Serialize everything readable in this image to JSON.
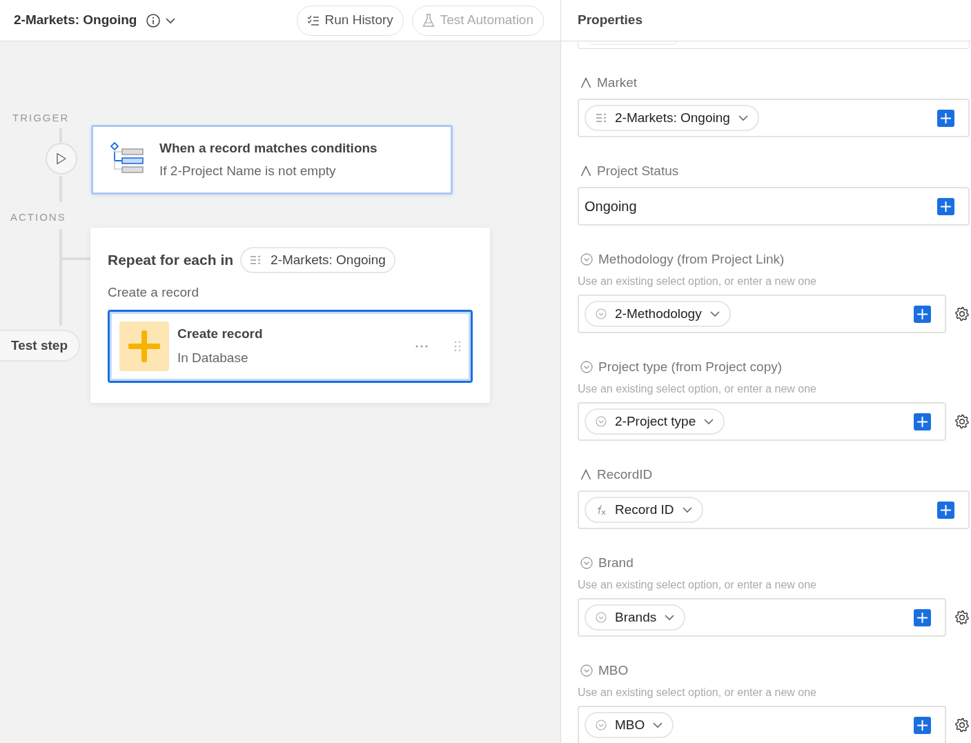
{
  "header": {
    "title": "2-Markets: Ongoing",
    "buttons": [
      {
        "kind": "history",
        "label": "Run History",
        "disabled": false
      },
      {
        "kind": "test",
        "label": "Test Automation",
        "disabled": true
      }
    ]
  },
  "canvas": {
    "trigger_label": "TRIGGER",
    "trigger": {
      "title": "When a record matches conditions",
      "subtitle": "If 2-Project Name is not empty"
    },
    "actions_label": "ACTIONS",
    "repeat": {
      "title": "Repeat for each in",
      "source": "2-Markets: Ongoing",
      "caption": "Create a record",
      "steps": [
        {
          "title": "Create record",
          "subtitle": "In Database",
          "selected": true
        }
      ]
    },
    "test_step": "Test step"
  },
  "properties": {
    "title": "Properties",
    "fields": [
      {
        "kind": "text",
        "label": "Market",
        "value": {
          "kind": "lookup",
          "text": "2-Markets: Ongoing"
        }
      },
      {
        "kind": "text",
        "label": "Project Status",
        "value": {
          "kind": "plain",
          "text": "Ongoing"
        }
      },
      {
        "kind": "select",
        "label": "Methodology (from Project Link)",
        "hint": "Use an existing select option, or enter a new one",
        "value": {
          "kind": "option",
          "text": "2-Methodology"
        }
      },
      {
        "kind": "select",
        "label": "Project type (from Project copy)",
        "hint": "Use an existing select option, or enter a new one",
        "value": {
          "kind": "option",
          "text": "2-Project type"
        }
      },
      {
        "kind": "text",
        "label": "RecordID",
        "value": {
          "kind": "formula",
          "text": "Record ID"
        }
      },
      {
        "kind": "select",
        "label": "Brand",
        "hint": "Use an existing select option, or enter a new one",
        "value": {
          "kind": "option",
          "text": "Brands"
        }
      },
      {
        "kind": "select",
        "label": "MBO",
        "hint": "Use an existing select option, or enter a new one",
        "value": {
          "kind": "option",
          "text": "MBO"
        }
      }
    ]
  }
}
